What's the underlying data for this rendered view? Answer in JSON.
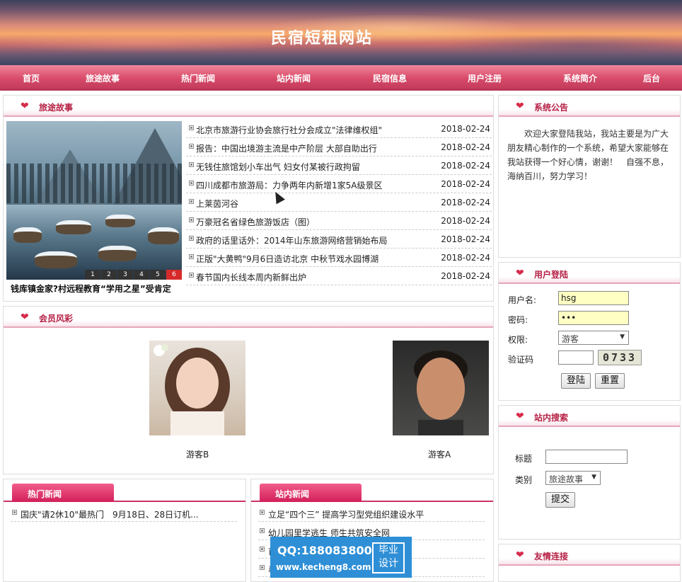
{
  "site": {
    "title": "民宿短租网站"
  },
  "nav": [
    "首页",
    "旅途故事",
    "热门新闻",
    "站内新闻",
    "民宿信息",
    "用户注册",
    "系统简介",
    "后台"
  ],
  "travel": {
    "title": "旅途故事",
    "caption": "钱库镇金家?村远程教育“学用之星”受肯定",
    "slides": [
      "1",
      "2",
      "3",
      "4",
      "5",
      "6"
    ],
    "items": [
      {
        "title": "北京市旅游行业协会旅行社分会成立\"法律维权组\"",
        "date": "2018-02-24"
      },
      {
        "title": "报告：中国出境游主流是中产阶层 大部自助出行",
        "date": "2018-02-24"
      },
      {
        "title": "无钱住旅馆划小车出气 妇女付某被行政拘留",
        "date": "2018-02-24"
      },
      {
        "title": "四川成都市旅游局：力争两年内新增1家5A级景区",
        "date": "2018-02-24"
      },
      {
        "title": "上莱茵河谷",
        "date": "2018-02-24"
      },
      {
        "title": "万豪冠名省绿色旅游饭店（图）",
        "date": "2018-02-24"
      },
      {
        "title": "政府的话里话外：2014年山东旅游网络营销始布局",
        "date": "2018-02-24"
      },
      {
        "title": "正版\"大黄鸭\"9月6日造访北京 中秋节戏水园博湖",
        "date": "2018-02-24"
      },
      {
        "title": "春节国内长线本周内新鲜出炉",
        "date": "2018-02-24"
      }
    ]
  },
  "members": {
    "title": "会员风彩",
    "list": [
      {
        "name": "游客B"
      },
      {
        "name": "游客A"
      }
    ]
  },
  "hot_news": {
    "tab": "热门新闻",
    "items": [
      "国庆\"请2休10\"最热门　9月18日、28日订机..."
    ]
  },
  "site_news": {
    "tab": "站内新闻",
    "items": [
      "立足“四个三” 提高学习型党组织建设水平",
      "幼儿园里学逃生 师生共筑安全网",
      "首",
      "奉"
    ]
  },
  "notice": {
    "title": "系统公告",
    "text": "欢迎大家登陆我站，我站主要是为广大朋友精心制作的一个系统，希望大家能够在我站获得一个好心情，谢谢！　自强不息，海纳百川，努力学习！"
  },
  "login": {
    "title": "用户登陆",
    "username_label": "用户名:",
    "username": "hsg",
    "password_label": "密码:",
    "password": "•••",
    "role_label": "权限:",
    "role": "游客",
    "captcha_label": "验证码",
    "captcha_value": "",
    "captcha": "0733",
    "login_btn": "登陆",
    "reset_btn": "重置"
  },
  "search": {
    "title": "站内搜索",
    "title_label": "标题",
    "title_value": "",
    "category_label": "类别",
    "category": "旅途故事",
    "submit": "提交"
  },
  "links": {
    "title": "友情连接"
  },
  "watermark": {
    "qq": "QQ:188083800",
    "url": "www.kecheng8.com",
    "badge1": "毕业",
    "badge2": "设计"
  },
  "colors": {
    "accent": "#d84b6a",
    "heading": "#b51f44",
    "tab": "#d21f5a"
  }
}
